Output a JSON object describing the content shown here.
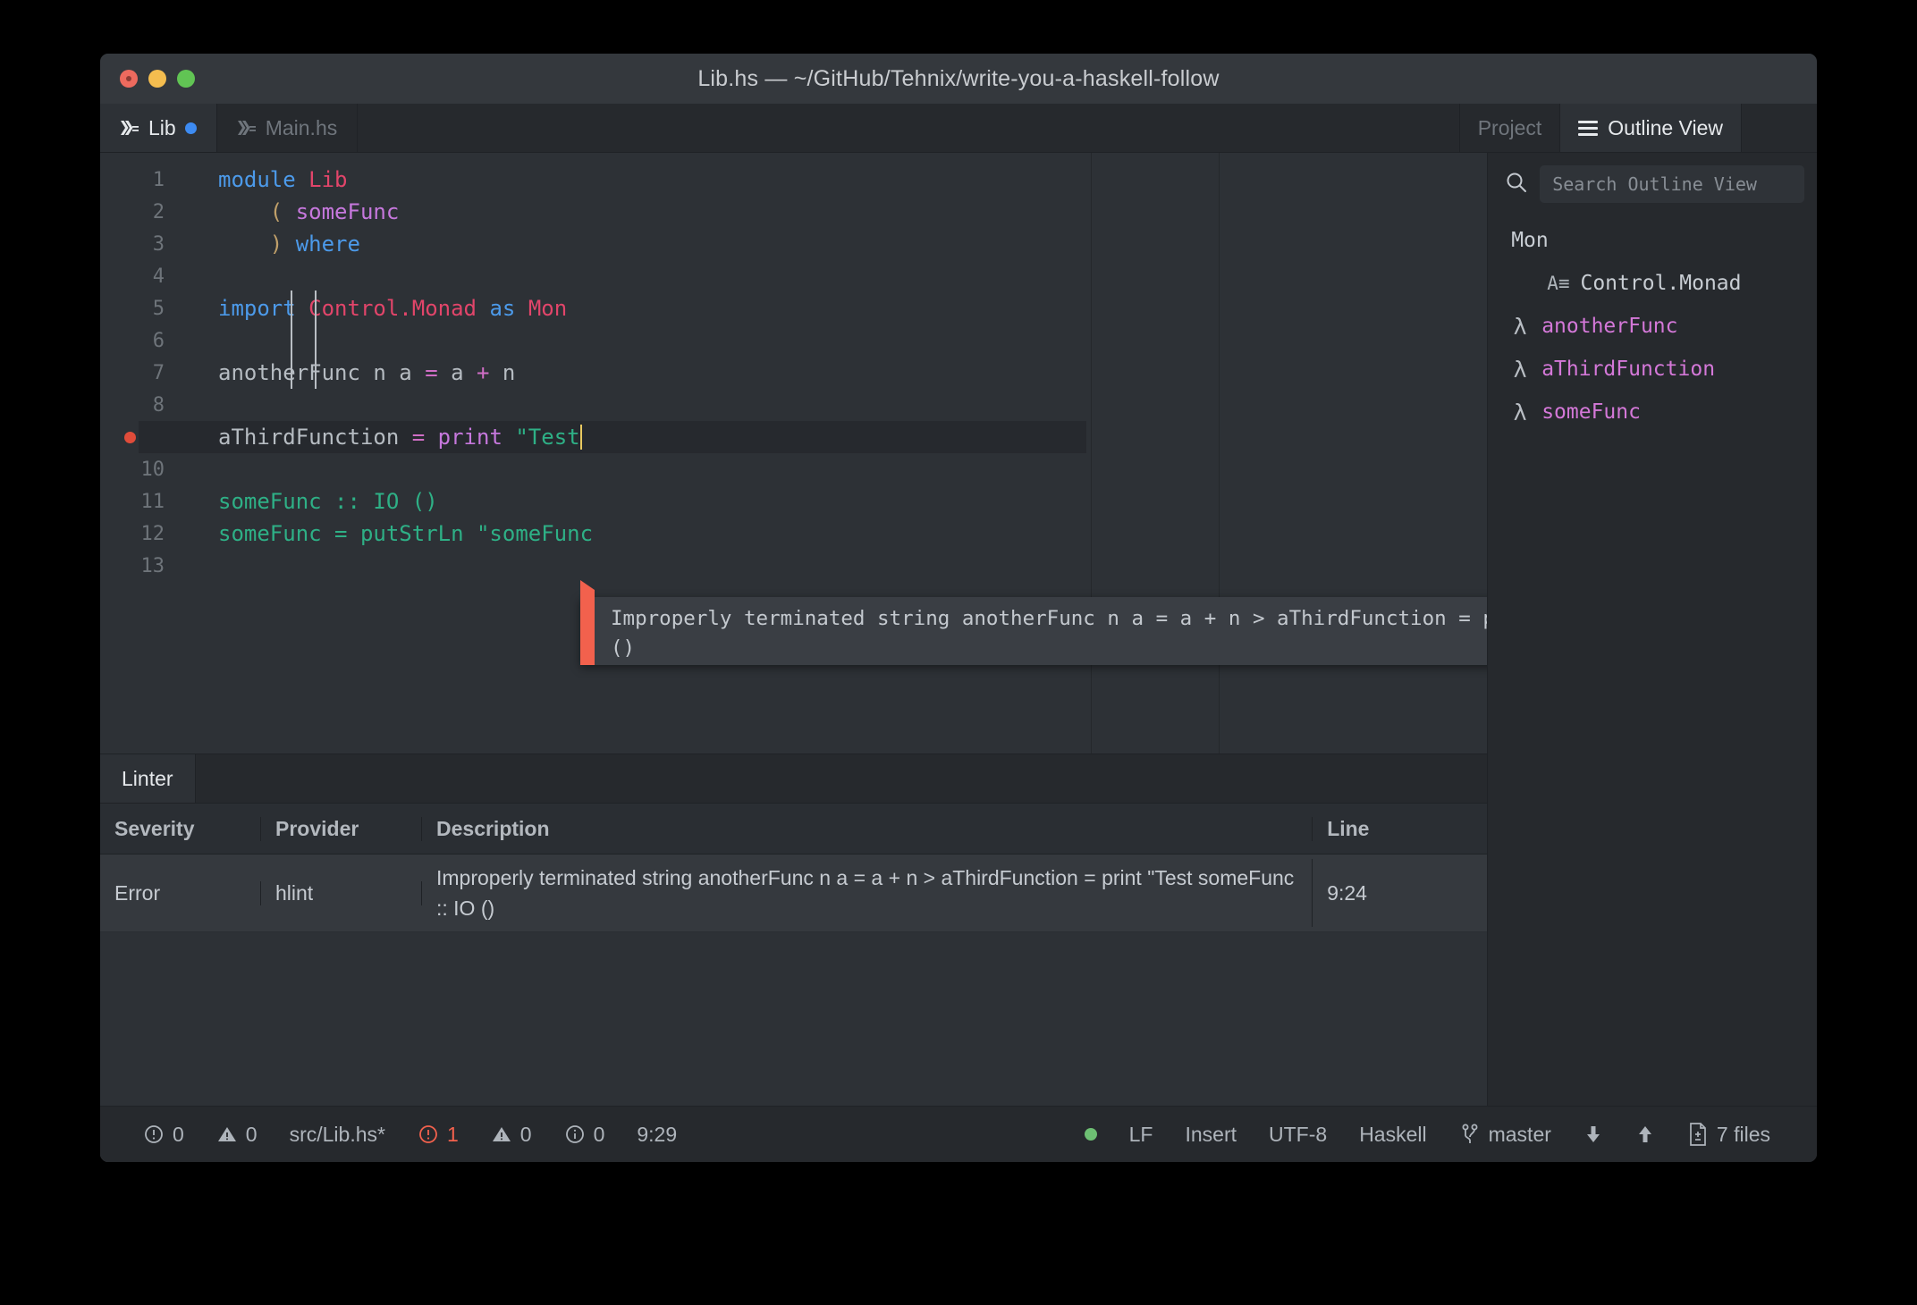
{
  "window": {
    "title": "Lib.hs — ~/GitHub/Tehnix/write-you-a-haskell-follow",
    "traffic_lights": [
      "close",
      "minimize",
      "zoom"
    ]
  },
  "tabs": [
    {
      "label": "Lib",
      "icon": "haskell-icon",
      "modified": true,
      "active": true
    },
    {
      "label": "Main.hs",
      "icon": "haskell-icon",
      "modified": false,
      "active": false
    }
  ],
  "dock_tabs": [
    {
      "label": "Project",
      "active": false
    },
    {
      "label": "Outline View",
      "icon": "list-icon",
      "active": true
    }
  ],
  "editor": {
    "gutter": {
      "breakpoint_line": 9
    },
    "lines": [
      {
        "n": "1",
        "tokens": [
          {
            "t": "module",
            "c": "kw"
          },
          {
            "t": " ",
            "c": "plain"
          },
          {
            "t": "Lib",
            "c": "type"
          }
        ]
      },
      {
        "n": "2",
        "tokens": [
          {
            "t": "    ",
            "c": "plain"
          },
          {
            "t": "(",
            "c": "paren"
          },
          {
            "t": " ",
            "c": "plain"
          },
          {
            "t": "someFunc",
            "c": "fn"
          }
        ]
      },
      {
        "n": "3",
        "tokens": [
          {
            "t": "    ",
            "c": "plain"
          },
          {
            "t": ")",
            "c": "paren"
          },
          {
            "t": " ",
            "c": "plain"
          },
          {
            "t": "where",
            "c": "kw"
          }
        ]
      },
      {
        "n": "4",
        "tokens": []
      },
      {
        "n": "5",
        "tokens": [
          {
            "t": "import",
            "c": "kw"
          },
          {
            "t": " ",
            "c": "plain"
          },
          {
            "t": "Control.Monad",
            "c": "type"
          },
          {
            "t": " ",
            "c": "plain"
          },
          {
            "t": "as",
            "c": "kw"
          },
          {
            "t": " ",
            "c": "plain"
          },
          {
            "t": "Mon",
            "c": "type"
          }
        ]
      },
      {
        "n": "6",
        "tokens": []
      },
      {
        "n": "7",
        "tokens": [
          {
            "t": "anotherFunc n a ",
            "c": "plain"
          },
          {
            "t": "=",
            "c": "op"
          },
          {
            "t": " a ",
            "c": "plain"
          },
          {
            "t": "+",
            "c": "op"
          },
          {
            "t": " n",
            "c": "plain"
          }
        ]
      },
      {
        "n": "8",
        "tokens": []
      },
      {
        "n": "9",
        "tokens": [
          {
            "t": "aThirdFunction ",
            "c": "plain"
          },
          {
            "t": "=",
            "c": "op"
          },
          {
            "t": " ",
            "c": "plain"
          },
          {
            "t": "print",
            "c": "fn"
          },
          {
            "t": " ",
            "c": "plain"
          },
          {
            "t": "\"Test",
            "c": "grn"
          }
        ],
        "current": true,
        "caret": true
      },
      {
        "n": "10",
        "tokens": []
      },
      {
        "n": "11",
        "tokens": [
          {
            "t": "someFunc :: IO ()",
            "c": "grn"
          }
        ]
      },
      {
        "n": "12",
        "tokens": [
          {
            "t": "someFunc = putStrLn \"someFunc",
            "c": "grn"
          }
        ]
      },
      {
        "n": "13",
        "tokens": []
      }
    ],
    "tooltip": "Improperly terminated string anotherFunc n a = a + n > aThirdFunction = print \"Test someFunc :: IO\n()"
  },
  "outline": {
    "search_placeholder": "Search Outline View",
    "items": [
      {
        "label": "Mon",
        "kind": "root",
        "icon": ""
      },
      {
        "label": "Control.Monad",
        "kind": "module",
        "icon": "A≡"
      },
      {
        "label": "anotherFunc",
        "kind": "func",
        "icon": "λ"
      },
      {
        "label": "aThirdFunction",
        "kind": "func",
        "icon": "λ"
      },
      {
        "label": "someFunc",
        "kind": "func",
        "icon": "λ"
      }
    ]
  },
  "linter": {
    "tab_label": "Linter",
    "columns": [
      "Severity",
      "Provider",
      "Description",
      "Line"
    ],
    "rows": [
      {
        "severity": "Error",
        "provider": "hlint",
        "description": "Improperly terminated string anotherFunc n a = a + n > aThirdFunction = print \"Test someFunc :: IO ()",
        "line": "9:24"
      }
    ]
  },
  "statusbar": {
    "left": [
      {
        "icon": "exclamation-circle-icon",
        "value": "0"
      },
      {
        "icon": "warning-triangle-icon",
        "value": "0"
      },
      {
        "icon": "",
        "value": "src/Lib.hs*"
      },
      {
        "icon": "error-circle-icon",
        "value": "1",
        "error": true
      },
      {
        "icon": "warning-triangle-icon",
        "value": "0"
      },
      {
        "icon": "info-circle-icon",
        "value": "0"
      },
      {
        "icon": "",
        "value": "9:29"
      }
    ],
    "right": [
      {
        "icon": "status-dot-icon",
        "value": ""
      },
      {
        "icon": "",
        "value": "LF"
      },
      {
        "icon": "",
        "value": "Insert"
      },
      {
        "icon": "",
        "value": "UTF-8"
      },
      {
        "icon": "",
        "value": "Haskell"
      },
      {
        "icon": "git-branch-icon",
        "value": "master"
      },
      {
        "icon": "arrow-down-icon",
        "value": ""
      },
      {
        "icon": "arrow-up-icon",
        "value": ""
      },
      {
        "icon": "file-diff-icon",
        "value": "7 files"
      }
    ]
  },
  "colors": {
    "window_bg": "#2d3136",
    "chrome_bg": "#26292d",
    "titlebar_bg": "#34383d",
    "accent_blue": "#3d8bf2",
    "error_red": "#f2614d",
    "breakpoint_red": "#e04c3a",
    "string_green": "#2eb086",
    "keyword_blue": "#4c9aea",
    "type_pink": "#e2456a",
    "func_purple": "#c678dd",
    "outline_purple": "#d478d8"
  }
}
